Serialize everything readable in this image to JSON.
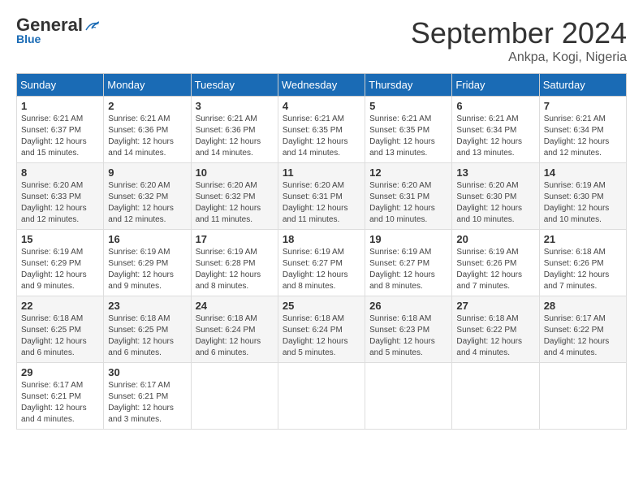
{
  "header": {
    "logo_general": "General",
    "logo_blue": "Blue",
    "month": "September 2024",
    "location": "Ankpa, Kogi, Nigeria"
  },
  "days_of_week": [
    "Sunday",
    "Monday",
    "Tuesday",
    "Wednesday",
    "Thursday",
    "Friday",
    "Saturday"
  ],
  "weeks": [
    [
      {
        "day": "1",
        "sunrise": "6:21 AM",
        "sunset": "6:37 PM",
        "daylight": "12 hours and 15 minutes."
      },
      {
        "day": "2",
        "sunrise": "6:21 AM",
        "sunset": "6:36 PM",
        "daylight": "12 hours and 14 minutes."
      },
      {
        "day": "3",
        "sunrise": "6:21 AM",
        "sunset": "6:36 PM",
        "daylight": "12 hours and 14 minutes."
      },
      {
        "day": "4",
        "sunrise": "6:21 AM",
        "sunset": "6:35 PM",
        "daylight": "12 hours and 14 minutes."
      },
      {
        "day": "5",
        "sunrise": "6:21 AM",
        "sunset": "6:35 PM",
        "daylight": "12 hours and 13 minutes."
      },
      {
        "day": "6",
        "sunrise": "6:21 AM",
        "sunset": "6:34 PM",
        "daylight": "12 hours and 13 minutes."
      },
      {
        "day": "7",
        "sunrise": "6:21 AM",
        "sunset": "6:34 PM",
        "daylight": "12 hours and 12 minutes."
      }
    ],
    [
      {
        "day": "8",
        "sunrise": "6:20 AM",
        "sunset": "6:33 PM",
        "daylight": "12 hours and 12 minutes."
      },
      {
        "day": "9",
        "sunrise": "6:20 AM",
        "sunset": "6:32 PM",
        "daylight": "12 hours and 12 minutes."
      },
      {
        "day": "10",
        "sunrise": "6:20 AM",
        "sunset": "6:32 PM",
        "daylight": "12 hours and 11 minutes."
      },
      {
        "day": "11",
        "sunrise": "6:20 AM",
        "sunset": "6:31 PM",
        "daylight": "12 hours and 11 minutes."
      },
      {
        "day": "12",
        "sunrise": "6:20 AM",
        "sunset": "6:31 PM",
        "daylight": "12 hours and 10 minutes."
      },
      {
        "day": "13",
        "sunrise": "6:20 AM",
        "sunset": "6:30 PM",
        "daylight": "12 hours and 10 minutes."
      },
      {
        "day": "14",
        "sunrise": "6:19 AM",
        "sunset": "6:30 PM",
        "daylight": "12 hours and 10 minutes."
      }
    ],
    [
      {
        "day": "15",
        "sunrise": "6:19 AM",
        "sunset": "6:29 PM",
        "daylight": "12 hours and 9 minutes."
      },
      {
        "day": "16",
        "sunrise": "6:19 AM",
        "sunset": "6:29 PM",
        "daylight": "12 hours and 9 minutes."
      },
      {
        "day": "17",
        "sunrise": "6:19 AM",
        "sunset": "6:28 PM",
        "daylight": "12 hours and 8 minutes."
      },
      {
        "day": "18",
        "sunrise": "6:19 AM",
        "sunset": "6:27 PM",
        "daylight": "12 hours and 8 minutes."
      },
      {
        "day": "19",
        "sunrise": "6:19 AM",
        "sunset": "6:27 PM",
        "daylight": "12 hours and 8 minutes."
      },
      {
        "day": "20",
        "sunrise": "6:19 AM",
        "sunset": "6:26 PM",
        "daylight": "12 hours and 7 minutes."
      },
      {
        "day": "21",
        "sunrise": "6:18 AM",
        "sunset": "6:26 PM",
        "daylight": "12 hours and 7 minutes."
      }
    ],
    [
      {
        "day": "22",
        "sunrise": "6:18 AM",
        "sunset": "6:25 PM",
        "daylight": "12 hours and 6 minutes."
      },
      {
        "day": "23",
        "sunrise": "6:18 AM",
        "sunset": "6:25 PM",
        "daylight": "12 hours and 6 minutes."
      },
      {
        "day": "24",
        "sunrise": "6:18 AM",
        "sunset": "6:24 PM",
        "daylight": "12 hours and 6 minutes."
      },
      {
        "day": "25",
        "sunrise": "6:18 AM",
        "sunset": "6:24 PM",
        "daylight": "12 hours and 5 minutes."
      },
      {
        "day": "26",
        "sunrise": "6:18 AM",
        "sunset": "6:23 PM",
        "daylight": "12 hours and 5 minutes."
      },
      {
        "day": "27",
        "sunrise": "6:18 AM",
        "sunset": "6:22 PM",
        "daylight": "12 hours and 4 minutes."
      },
      {
        "day": "28",
        "sunrise": "6:17 AM",
        "sunset": "6:22 PM",
        "daylight": "12 hours and 4 minutes."
      }
    ],
    [
      {
        "day": "29",
        "sunrise": "6:17 AM",
        "sunset": "6:21 PM",
        "daylight": "12 hours and 4 minutes."
      },
      {
        "day": "30",
        "sunrise": "6:17 AM",
        "sunset": "6:21 PM",
        "daylight": "12 hours and 3 minutes."
      },
      null,
      null,
      null,
      null,
      null
    ]
  ]
}
